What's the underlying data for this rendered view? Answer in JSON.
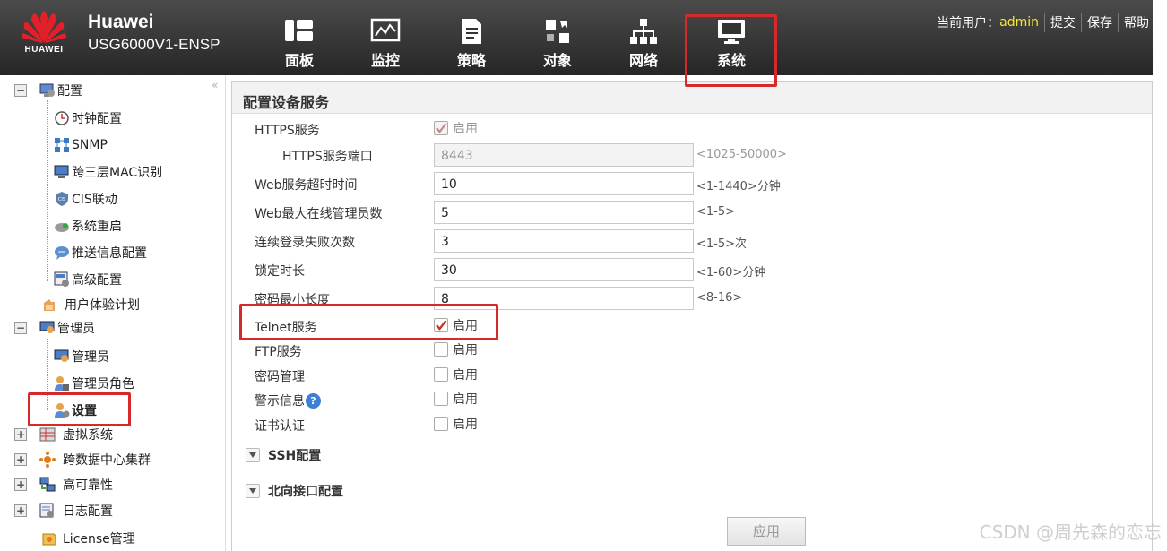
{
  "brand": {
    "logo_text": "HUAWEI",
    "name": "Huawei",
    "model": "USG6000V1-ENSP"
  },
  "nav": [
    {
      "label": "面板",
      "icon": "dashboard-icon"
    },
    {
      "label": "监控",
      "icon": "monitor-icon"
    },
    {
      "label": "策略",
      "icon": "policy-icon"
    },
    {
      "label": "对象",
      "icon": "object-icon"
    },
    {
      "label": "网络",
      "icon": "network-icon"
    },
    {
      "label": "系统",
      "icon": "system-icon",
      "selected": true
    }
  ],
  "user": {
    "prefix": "当前用户：",
    "name": "admin",
    "submit": "提交",
    "save": "保存",
    "help": "帮助"
  },
  "sidebar": {
    "collapse": "«",
    "items": [
      {
        "label": "配置",
        "expanded": true
      },
      {
        "label": "时钟配置"
      },
      {
        "label": "SNMP"
      },
      {
        "label": "跨三层MAC识别"
      },
      {
        "label": "CIS联动"
      },
      {
        "label": "系统重启"
      },
      {
        "label": "推送信息配置"
      },
      {
        "label": "高级配置"
      },
      {
        "label": "用户体验计划"
      },
      {
        "label": "管理员",
        "expanded": true
      },
      {
        "label": "管理员"
      },
      {
        "label": "管理员角色"
      },
      {
        "label": "设置",
        "selected": true
      },
      {
        "label": "虚拟系统",
        "expanded": false
      },
      {
        "label": "跨数据中心集群",
        "expanded": false
      },
      {
        "label": "高可靠性",
        "expanded": false
      },
      {
        "label": "日志配置",
        "expanded": false
      },
      {
        "label": "License管理"
      }
    ]
  },
  "page": {
    "title": "配置设备服务",
    "https": {
      "label": "HTTPS服务",
      "enable": "启用",
      "checked": true
    },
    "https_port": {
      "label": "HTTPS服务端口",
      "value": "8443",
      "hint": "<1025-50000>"
    },
    "web_timeout": {
      "label": "Web服务超时时间",
      "value": "10",
      "hint": "<1-1440>分钟"
    },
    "web_max_admins": {
      "label": "Web最大在线管理员数",
      "value": "5",
      "hint": "<1-5>"
    },
    "login_fail": {
      "label": "连续登录失败次数",
      "value": "3",
      "hint": "<1-5>次"
    },
    "lock_time": {
      "label": "锁定时长",
      "value": "30",
      "hint": "<1-60>分钟"
    },
    "pwd_min_len": {
      "label": "密码最小长度",
      "value": "8",
      "hint": "<8-16>"
    },
    "telnet": {
      "label": "Telnet服务",
      "enable": "启用",
      "checked": true
    },
    "ftp": {
      "label": "FTP服务",
      "enable": "启用",
      "checked": false
    },
    "pwd_mgmt": {
      "label": "密码管理",
      "enable": "启用",
      "checked": false
    },
    "warning": {
      "label": "警示信息",
      "enable": "启用",
      "checked": false,
      "help": "?"
    },
    "cert_auth": {
      "label": "证书认证",
      "enable": "启用",
      "checked": false
    },
    "ssh_section": "SSH配置",
    "north_section": "北向接口配置",
    "apply": "应用"
  },
  "watermark": "CSDN @周先森的恋忘",
  "colors": {
    "highlight": "#d62a28",
    "header_bg": "#333333",
    "user_name": "#f7e72f",
    "check_mark": "#c0392b"
  }
}
